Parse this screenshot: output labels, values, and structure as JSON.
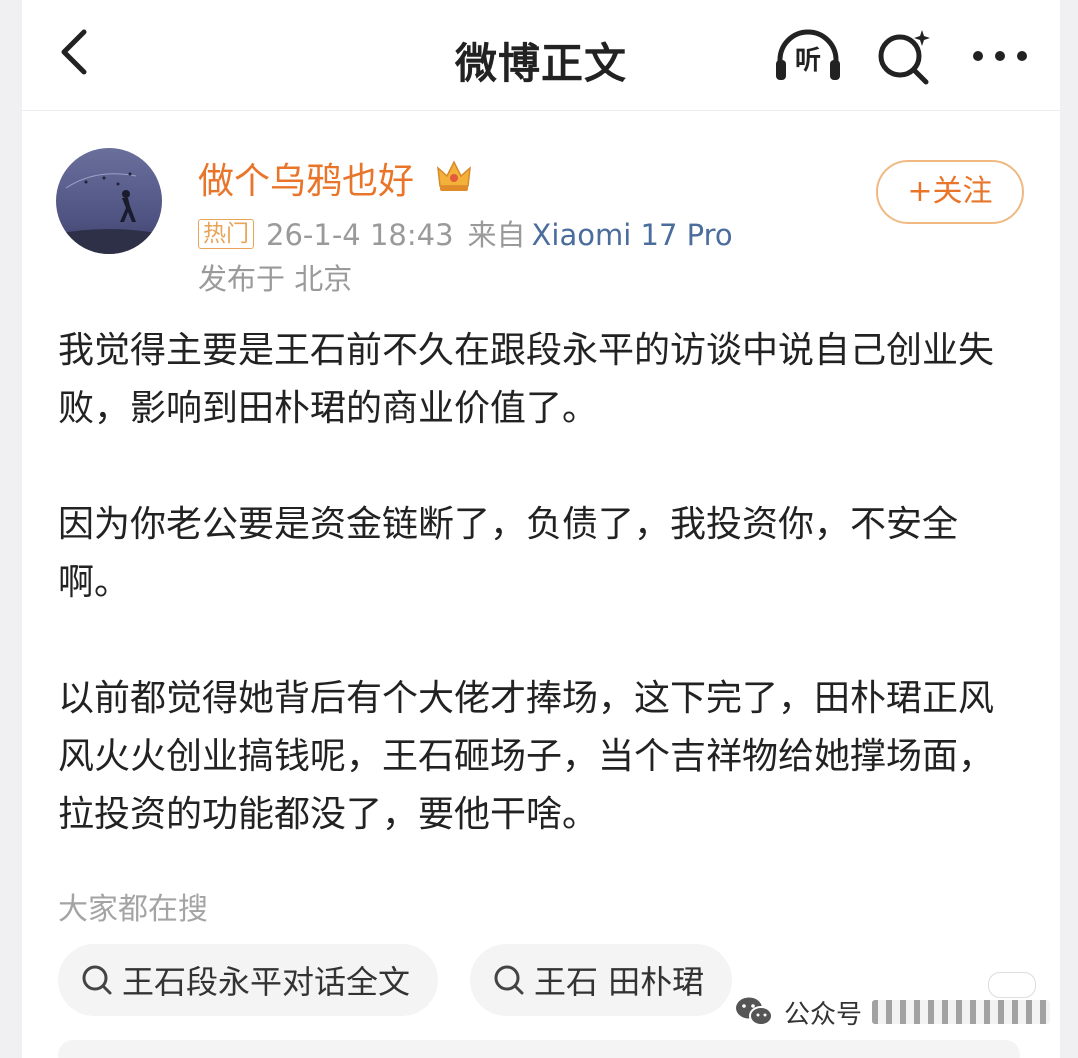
{
  "header": {
    "title": "微博正文",
    "listen_label": "听"
  },
  "author": {
    "name": "做个乌鸦也好",
    "badge": "热门",
    "time": "26-1-4 18:43",
    "from_label": "来自",
    "device": "Xiaomi 17 Pro",
    "location": "发布于 北京",
    "follow_label": "+关注"
  },
  "post": {
    "paragraphs": [
      "我觉得主要是王石前不久在跟段永平的访谈中说自己创业失败，影响到田朴珺的商业价值了。",
      "因为你老公要是资金链断了，负债了，我投资你，不安全啊。",
      "以前都觉得她背后有个大佬才捧场，这下完了，田朴珺正风风火火创业搞钱呢，王石砸场子，当个吉祥物给她撑场面，拉投资的功能都没了，要他干啥。"
    ]
  },
  "suggestions": {
    "title": "大家都在搜",
    "items": [
      {
        "label": "王石段永平对话全文"
      },
      {
        "label": "王石 田朴珺"
      }
    ]
  },
  "watermark": {
    "label": "公众号"
  },
  "colors": {
    "accent": "#e8752a",
    "link": "#4a6d9c",
    "muted": "#9a9a9a"
  }
}
